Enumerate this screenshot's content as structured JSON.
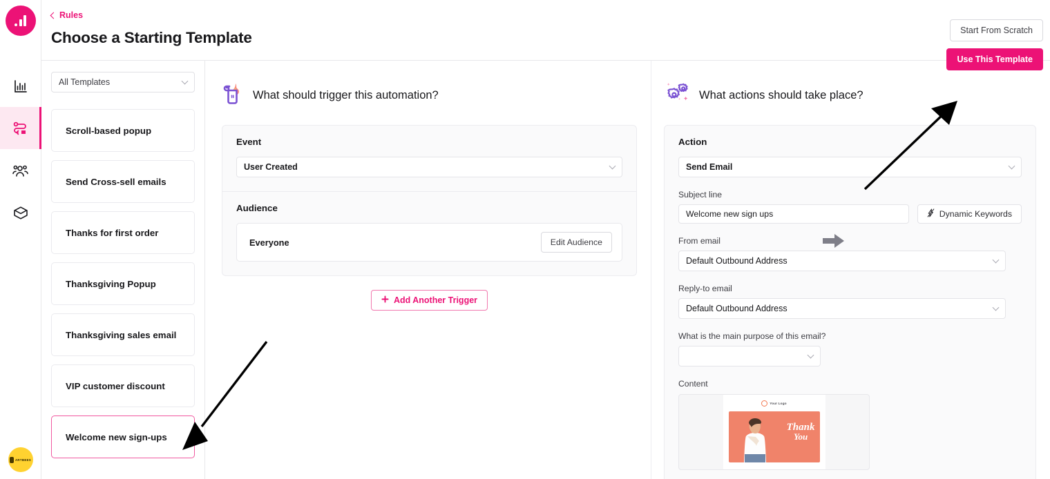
{
  "brand": {
    "accent": "#ec1276",
    "accent_soft": "#fde8f1",
    "avatar_bg": "#ffd230",
    "avatar_label": "ARTBEES"
  },
  "rail": {
    "logo_name": "bar-chart-logo",
    "items": [
      {
        "name": "sidebar-item-analytics",
        "icon": "bar-chart-icon",
        "active": false
      },
      {
        "name": "sidebar-item-rules",
        "icon": "flow-rules-icon",
        "active": true
      },
      {
        "name": "sidebar-item-audience",
        "icon": "people-icon",
        "active": false
      },
      {
        "name": "sidebar-item-products",
        "icon": "box-icon",
        "active": false
      }
    ]
  },
  "topbar": {
    "breadcrumb": "Rules",
    "title": "Choose a Starting Template",
    "start_from_scratch": "Start From Scratch"
  },
  "templates": {
    "filter_value": "All Templates",
    "items": [
      {
        "label": "Scroll-based popup",
        "selected": false
      },
      {
        "label": "Send Cross-sell emails",
        "selected": false
      },
      {
        "label": "Thanks for first order",
        "selected": false
      },
      {
        "label": "Thanksgiving Popup",
        "selected": false
      },
      {
        "label": "Thanksgiving sales email",
        "selected": false
      },
      {
        "label": "VIP customer discount",
        "selected": false
      },
      {
        "label": "Welcome new sign-ups",
        "selected": true
      }
    ]
  },
  "trigger": {
    "icon": "lighter-flame-icon",
    "heading": "What should trigger this automation?",
    "event_label": "Event",
    "event_value": "User Created",
    "audience_label": "Audience",
    "audience_value": "Everyone",
    "edit_audience": "Edit Audience",
    "add_another_trigger": "Add Another Trigger"
  },
  "actions": {
    "icon": "gears-sparkle-icon",
    "heading": "What actions should take place?",
    "use_this_template": "Use This Template",
    "action_label": "Action",
    "action_value": "Send Email",
    "subject_label": "Subject line",
    "subject_value": "Welcome new sign ups",
    "dynamic_keywords": "Dynamic Keywords",
    "from_label": "From email",
    "from_value": "Default Outbound Address",
    "reply_label": "Reply-to email",
    "reply_value": "Default Outbound Address",
    "purpose_label": "What is the main purpose of this email?",
    "purpose_value": "",
    "content_label": "Content",
    "preview": {
      "logo_text": "Your Logo",
      "banner_line1": "Thank",
      "banner_line2": "You"
    }
  }
}
